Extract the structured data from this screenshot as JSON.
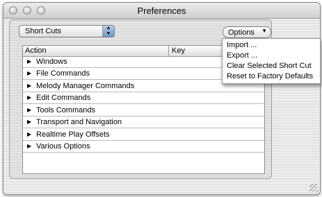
{
  "window": {
    "title": "Preferences"
  },
  "popup": {
    "selected": "Short Cuts"
  },
  "options": {
    "label": "Options"
  },
  "table": {
    "columns": [
      "Action",
      "Key"
    ],
    "rows": [
      "Windows",
      "File Commands",
      "Melody Manager Commands",
      "Edit Commands",
      "Tools Commands",
      "Transport and Navigation",
      "Realtime Play Offsets",
      "Various Options"
    ]
  },
  "menu": {
    "items": [
      "Import ...",
      "Export ...",
      "Clear Selected Short Cut",
      "Reset to Factory Defaults"
    ]
  }
}
